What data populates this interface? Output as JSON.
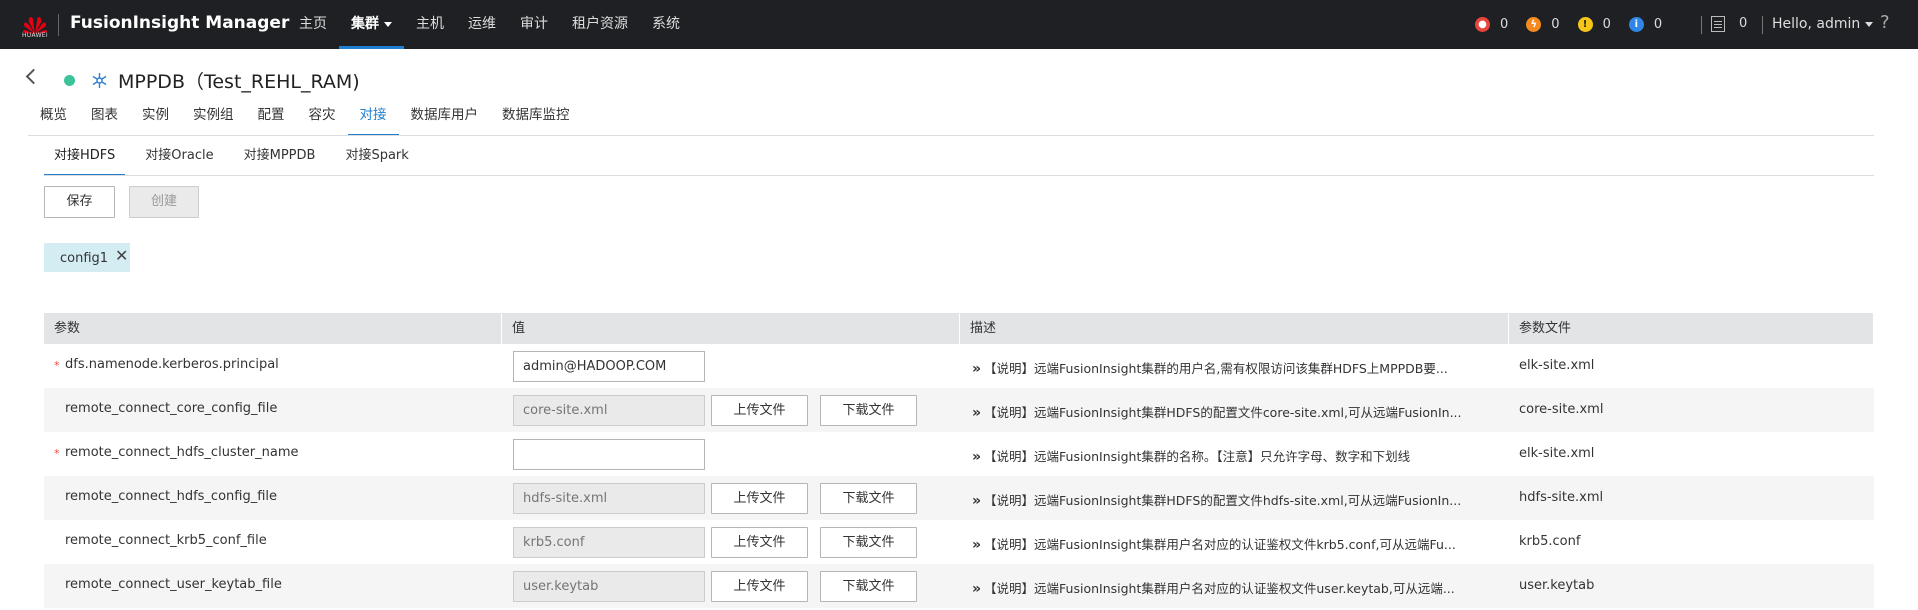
{
  "top_bar": {
    "brand": "HUAWEI",
    "product": "FusionInsight Manager",
    "nav": [
      {
        "label": "主页",
        "active": false
      },
      {
        "label": "集群",
        "active": true
      },
      {
        "label": "主机",
        "active": false
      },
      {
        "label": "运维",
        "active": false
      },
      {
        "label": "审计",
        "active": false
      },
      {
        "label": "租户资源",
        "active": false
      },
      {
        "label": "系统",
        "active": false
      }
    ],
    "alarms": [
      {
        "name": "critical",
        "icon": "flame-icon",
        "color": "#e8453c",
        "count": "0"
      },
      {
        "name": "major",
        "icon": "bolt-icon",
        "color": "#f58a1f",
        "count": "0"
      },
      {
        "name": "minor",
        "icon": "exclamation-icon",
        "color": "#f5c518",
        "count": "0"
      },
      {
        "name": "info",
        "icon": "info-icon",
        "color": "#2f86e6",
        "count": "0"
      }
    ],
    "tasks_count": "0",
    "user": "Hello, admin",
    "help": "?"
  },
  "header": {
    "title": "MPPDB（Test_REHL_RAM)",
    "status_color": "#3cc39a"
  },
  "tabs": [
    {
      "label": "概览",
      "active": false
    },
    {
      "label": "图表",
      "active": false
    },
    {
      "label": "实例",
      "active": false
    },
    {
      "label": "实例组",
      "active": false
    },
    {
      "label": "配置",
      "active": false
    },
    {
      "label": "容灾",
      "active": false
    },
    {
      "label": "对接",
      "active": true
    },
    {
      "label": "数据库用户",
      "active": false
    },
    {
      "label": "数据库监控",
      "active": false
    }
  ],
  "sub_tabs": [
    {
      "label": "对接HDFS",
      "active": true
    },
    {
      "label": "对接Oracle",
      "active": false
    },
    {
      "label": "对接MPPDB",
      "active": false
    },
    {
      "label": "对接Spark",
      "active": false
    }
  ],
  "actions": {
    "save": "保存",
    "create": "创建"
  },
  "config_chip": {
    "label": "config1",
    "close": "✕"
  },
  "table": {
    "headers": [
      "参数",
      "值",
      "描述",
      "参数文件"
    ],
    "upload_label": "上传文件",
    "download_label": "下载文件",
    "rows": [
      {
        "required": true,
        "name": "dfs.namenode.kerberos.principal",
        "value": "admin@HADOOP.COM",
        "readonly": false,
        "has_file_buttons": false,
        "description": "【说明】远端FusionInsight集群的用户名,需有权限访问该集群HDFS上MPPDB要...",
        "file": "elk-site.xml"
      },
      {
        "required": false,
        "name": "remote_connect_core_config_file",
        "value": "core-site.xml",
        "readonly": true,
        "has_file_buttons": true,
        "description": "【说明】远端FusionInsight集群HDFS的配置文件core-site.xml,可从远端FusionIn...",
        "file": "core-site.xml"
      },
      {
        "required": true,
        "name": "remote_connect_hdfs_cluster_name",
        "value": "",
        "readonly": false,
        "has_file_buttons": false,
        "description": "【说明】远端FusionInsight集群的名称。【注意】只允许字母、数字和下划线",
        "file": "elk-site.xml"
      },
      {
        "required": false,
        "name": "remote_connect_hdfs_config_file",
        "value": "hdfs-site.xml",
        "readonly": true,
        "has_file_buttons": true,
        "description": "【说明】远端FusionInsight集群HDFS的配置文件hdfs-site.xml,可从远端FusionIn...",
        "file": "hdfs-site.xml"
      },
      {
        "required": false,
        "name": "remote_connect_krb5_conf_file",
        "value": "krb5.conf",
        "readonly": true,
        "has_file_buttons": true,
        "description": "【说明】远端FusionInsight集群用户名对应的认证鉴权文件krb5.conf,可从远端Fu...",
        "file": "krb5.conf"
      },
      {
        "required": false,
        "name": "remote_connect_user_keytab_file",
        "value": "user.keytab",
        "readonly": true,
        "has_file_buttons": true,
        "description": "【说明】远端FusionInsight集群用户名对应的认证鉴权文件user.keytab,可从远端...",
        "file": "user.keytab"
      }
    ]
  }
}
